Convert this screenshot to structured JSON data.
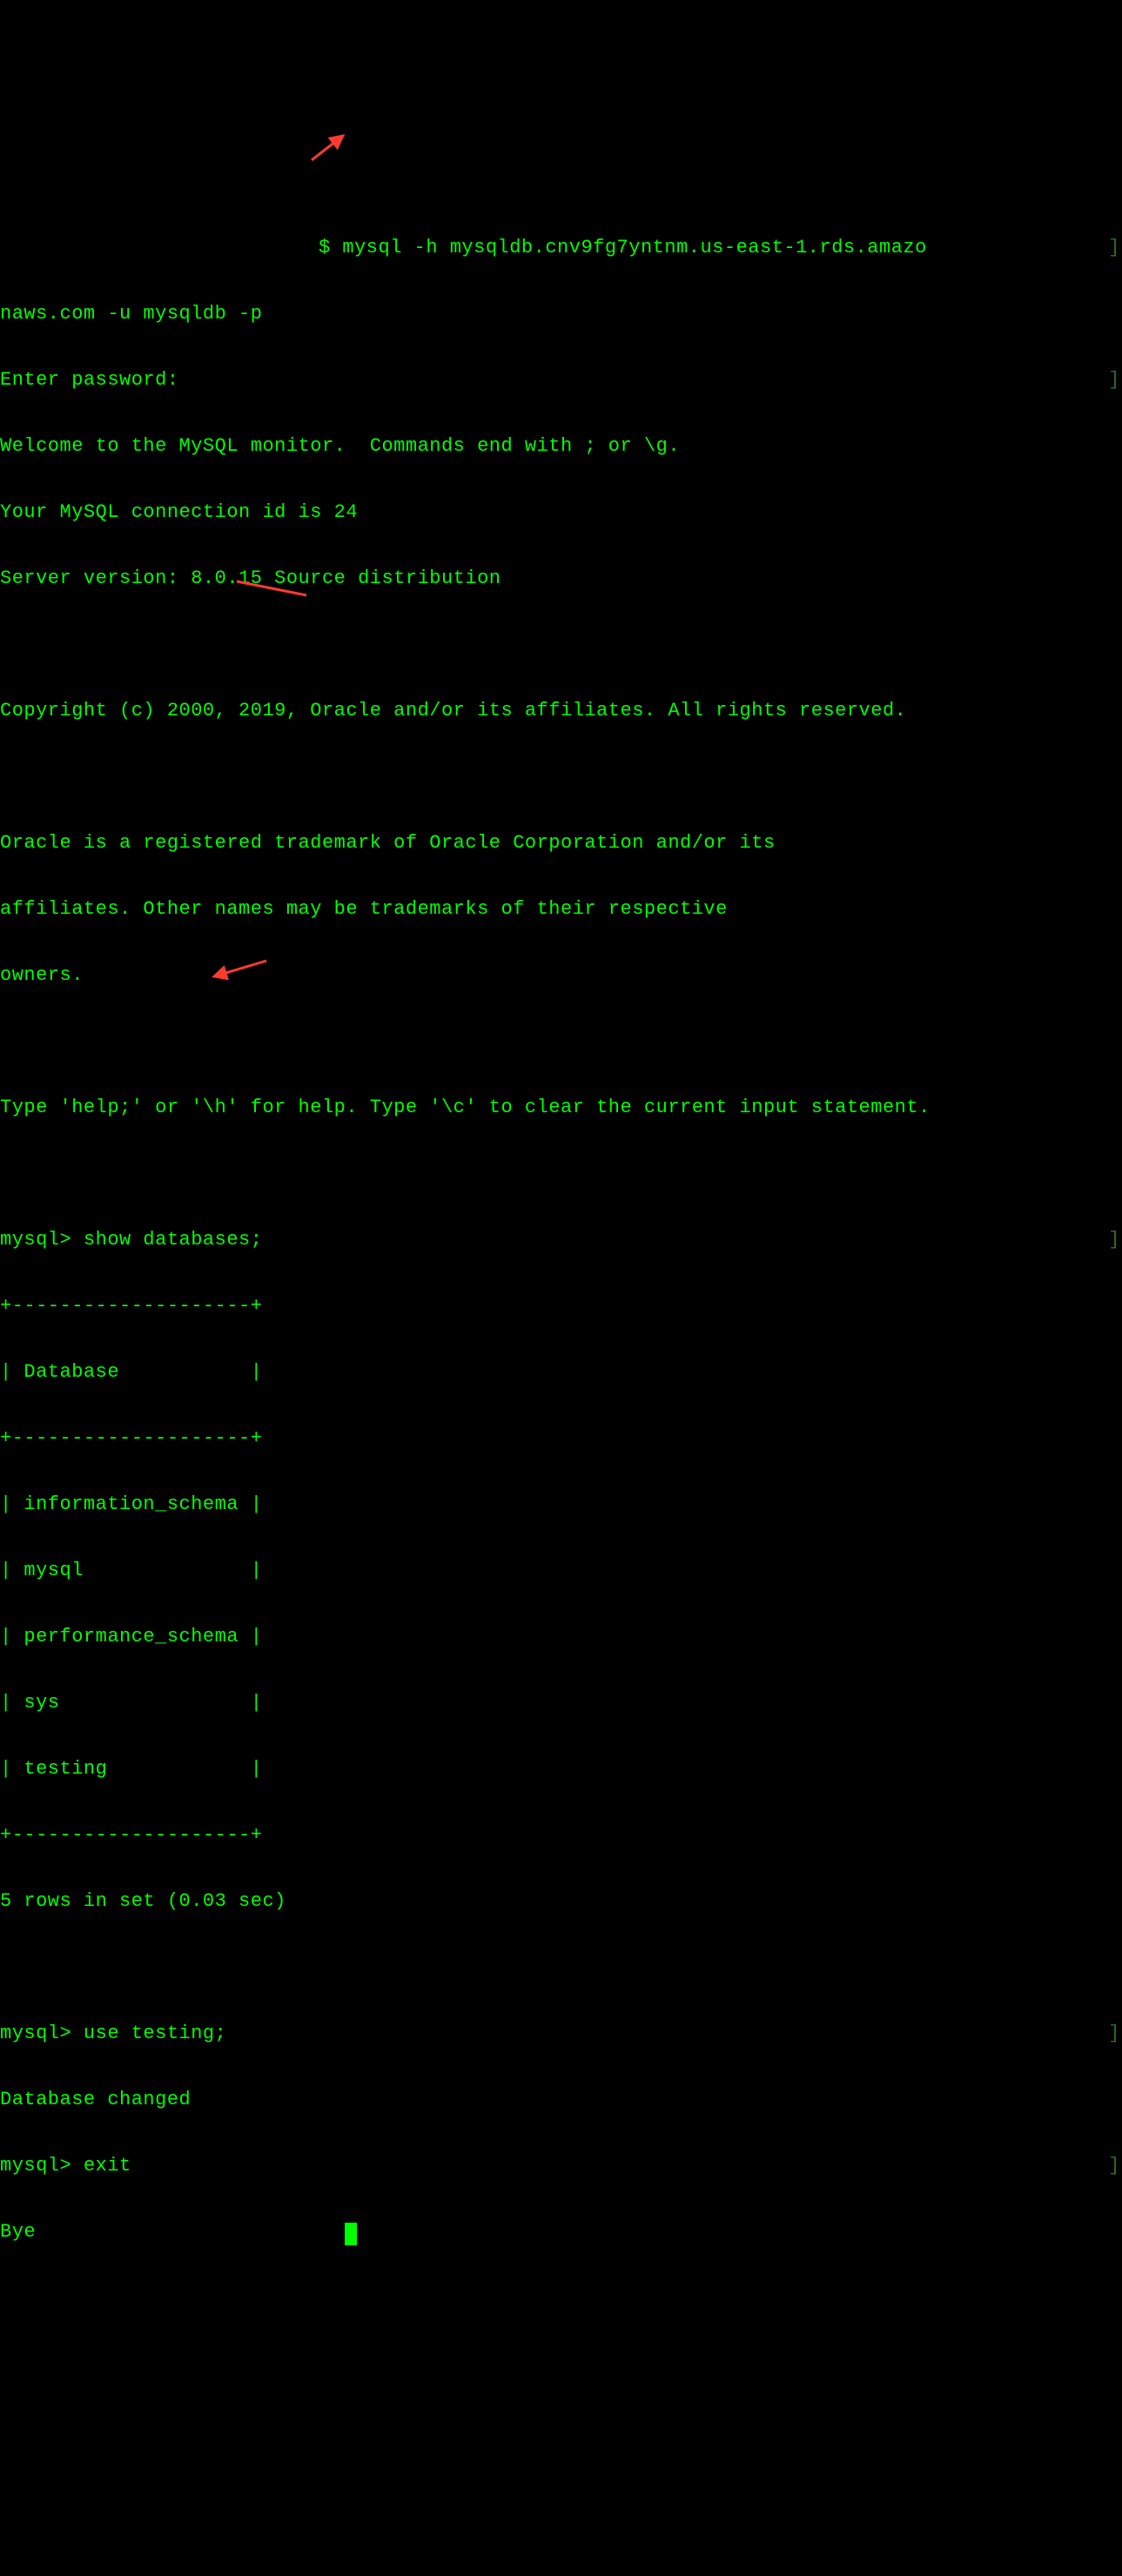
{
  "terminal": {
    "cmd_line1": "$ mysql -h mysqldb.cnv9fg7yntnm.us-east-1.rds.amazo",
    "cmd_line2": "naws.com -u mysqldb -p",
    "enter_password": "Enter password:",
    "welcome": "Welcome to the MySQL monitor.  Commands end with ; or \\g.",
    "conn_id": "Your MySQL connection id is 24",
    "server_ver": "Server version: 8.0.15 Source distribution",
    "copyright": "Copyright (c) 2000, 2019, Oracle and/or its affiliates. All rights reserved.",
    "oracle1": "Oracle is a registered trademark of Oracle Corporation and/or its",
    "oracle2": "affiliates. Other names may be trademarks of their respective",
    "oracle3": "owners.",
    "help": "Type 'help;' or '\\h' for help. Type '\\c' to clear the current input statement.",
    "prompt_show": "mysql> show databases;",
    "table_top": "+--------------------+",
    "table_header": "| Database           |",
    "table_sep": "+--------------------+",
    "row1": "| information_schema |",
    "row2": "| mysql              |",
    "row3": "| performance_schema |",
    "row4": "| sys                |",
    "row5": "| testing            |",
    "table_bot": "+--------------------+",
    "rows_summary": "5 rows in set (0.03 sec)",
    "prompt_use": "mysql> use testing;",
    "db_changed": "Database changed",
    "prompt_exit": "mysql> exit",
    "bye": "Bye"
  },
  "annotations": {
    "arrow_color": "#ff3b30"
  }
}
